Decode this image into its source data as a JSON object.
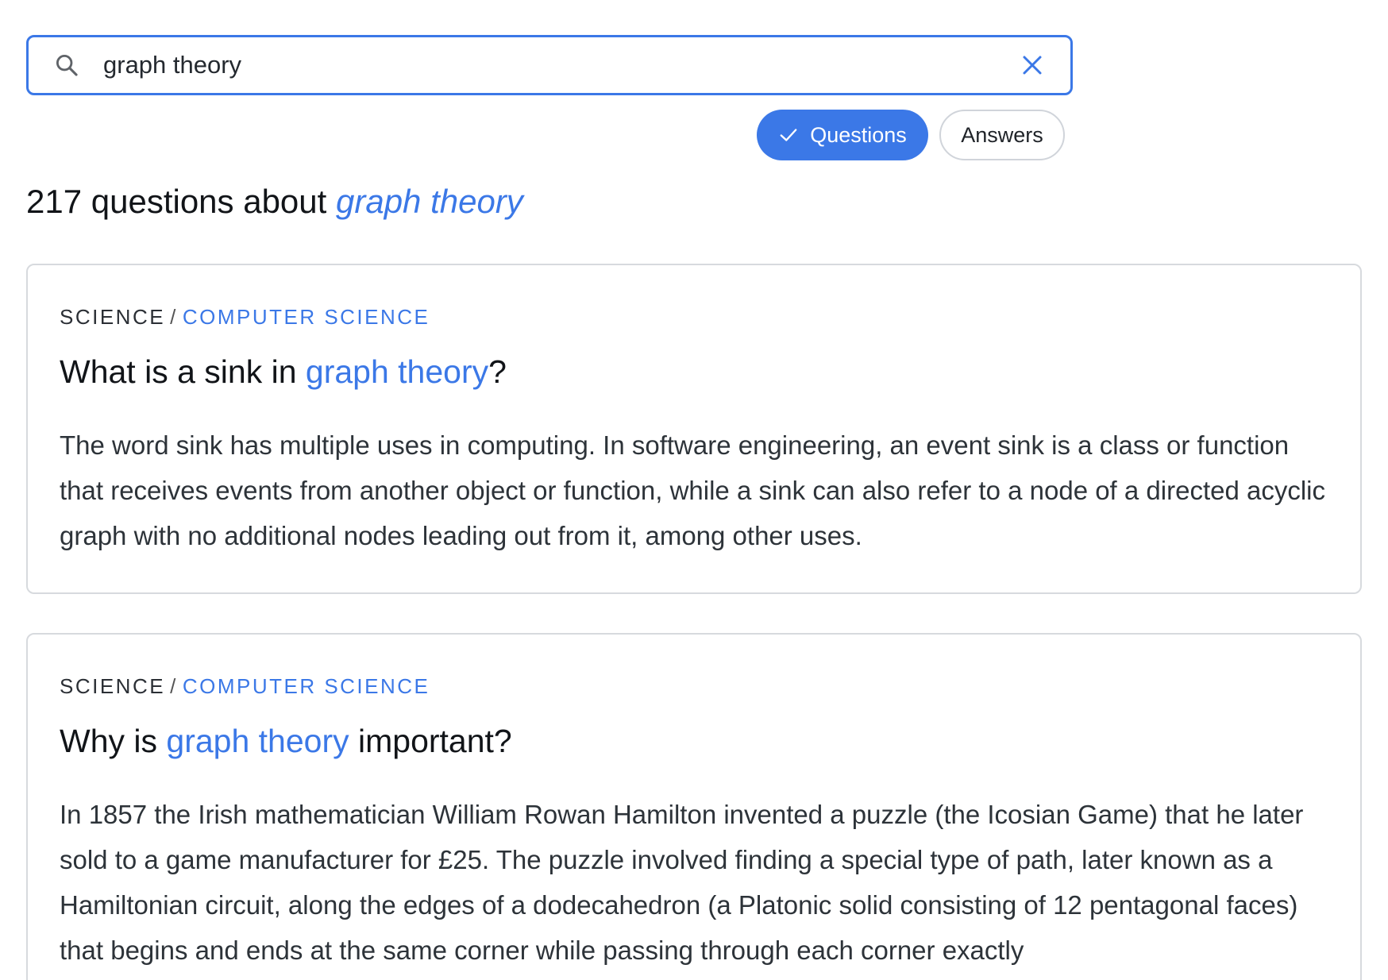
{
  "search": {
    "value": "graph theory",
    "placeholder": ""
  },
  "filters": {
    "questions_label": "Questions",
    "answers_label": "Answers",
    "selected": "Questions"
  },
  "results_heading": {
    "prefix": "217 questions about ",
    "term": "graph theory"
  },
  "results": [
    {
      "category": "SCIENCE",
      "separator": "/",
      "subcategory": "COMPUTER SCIENCE",
      "title_before": "What is a sink in ",
      "title_highlight": "graph theory",
      "title_after": "?",
      "excerpt": "The word sink has multiple uses in computing. In software engineering, an event sink is a class or function that receives events from another object or function, while a sink can also refer to a node of a directed acyclic graph with no additional nodes leading out from it, among other uses."
    },
    {
      "category": "SCIENCE",
      "separator": "/",
      "subcategory": "COMPUTER SCIENCE",
      "title_before": "Why is ",
      "title_highlight": "graph theory",
      "title_after": " important?",
      "excerpt": "In 1857 the Irish mathematician William Rowan Hamilton invented a puzzle (the Icosian Game) that he later sold to a game manufacturer for £25. The puzzle involved finding a special type of path, later known as a Hamiltonian circuit, along the edges of a dodecahedron (a Platonic solid consisting of 12 pentagonal faces) that begins and ends at the same corner while passing through each corner exactly"
    }
  ],
  "colors": {
    "accent": "#3b78e7",
    "text": "#111418",
    "body_text": "#2d3339",
    "border": "#d7dade"
  },
  "icons": {
    "search": "search-icon",
    "clear": "close-icon",
    "selected_chip": "check-icon"
  }
}
